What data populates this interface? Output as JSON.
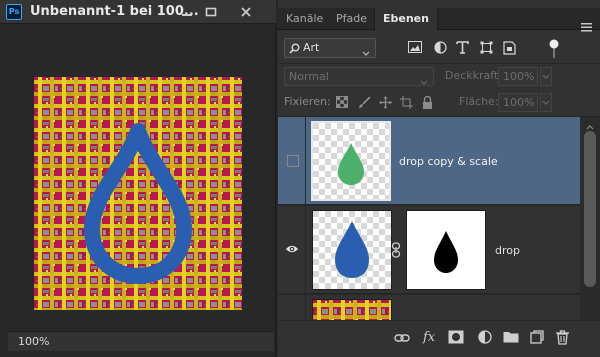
{
  "document": {
    "title": "Unbenannt-1 bei 100...",
    "app_badge": "Ps",
    "zoom": "100%",
    "window_buttons": [
      "minimize-icon",
      "maximize-icon",
      "close-icon"
    ]
  },
  "panel": {
    "tabs": [
      {
        "label": "Kanäle",
        "active": false
      },
      {
        "label": "Pfade",
        "active": false
      },
      {
        "label": "Ebenen",
        "active": true
      }
    ],
    "filter": {
      "kind_label": "Art",
      "icons": [
        "pixel-layer-filter-icon",
        "adjustment-layer-filter-icon",
        "type-layer-filter-icon",
        "shape-layer-filter-icon",
        "smart-object-filter-icon"
      ]
    },
    "blend_mode": "Normal",
    "opacity_label": "Deckkraft:",
    "opacity_value": "100%",
    "lock_label": "Fixieren:",
    "lock_icons": [
      "lock-transparency-icon",
      "lock-image-icon",
      "lock-position-icon",
      "lock-artboard-icon",
      "lock-all-icon"
    ],
    "fill_label": "Fläche:",
    "fill_value": "100%",
    "layers": [
      {
        "name": "drop copy & scale",
        "visible": false,
        "selected": true,
        "drop_color": "#4cb06a"
      },
      {
        "name": "drop",
        "visible": true,
        "selected": false,
        "drop_color": "#2a5eb0",
        "has_mask": true
      },
      {
        "name": "",
        "visible": true,
        "selected": false
      }
    ],
    "footer_icons": [
      "link-layers-icon",
      "fx-icon",
      "add-mask-icon",
      "adjustment-layer-icon",
      "new-group-icon",
      "new-layer-icon",
      "delete-layer-icon"
    ],
    "fx_label": "fx"
  },
  "colors": {
    "selected_layer": "#4e6785",
    "drop_blue": "#2a5eb0",
    "drop_green": "#4cb06a",
    "accent_ps": "#31a8ff"
  }
}
